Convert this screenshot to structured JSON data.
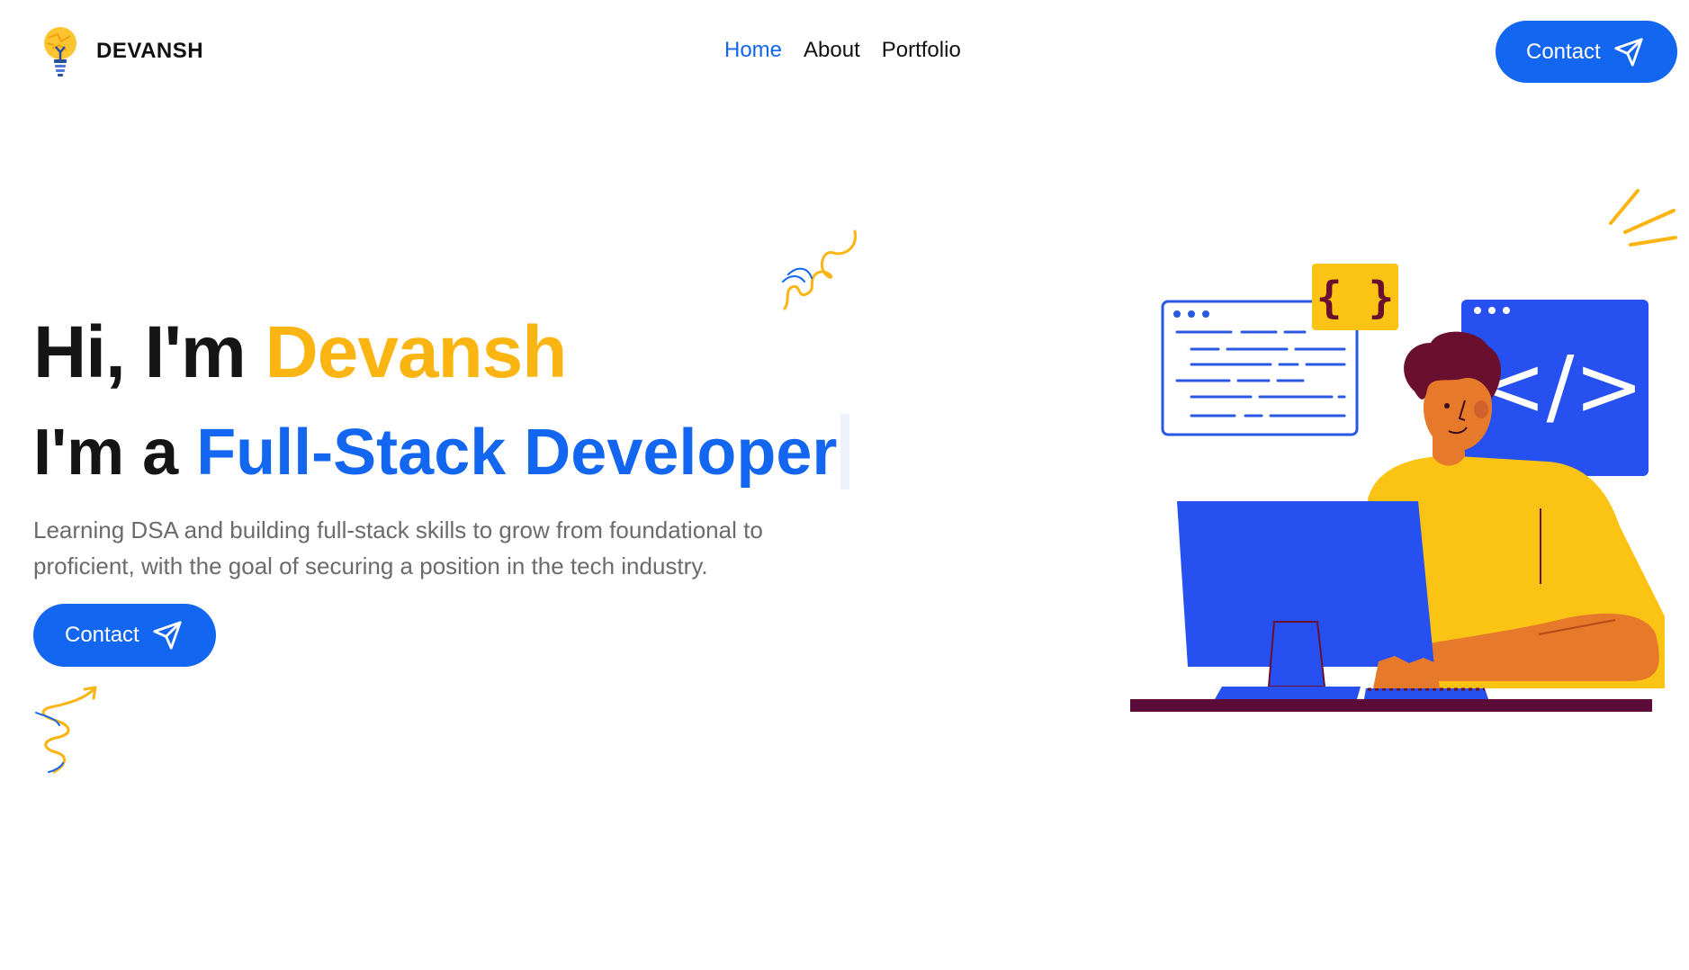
{
  "header": {
    "brand": "DEVANSH",
    "nav": [
      {
        "label": "Home",
        "active": true
      },
      {
        "label": "About",
        "active": false
      },
      {
        "label": "Portfolio",
        "active": false
      }
    ],
    "contact_label": "Contact"
  },
  "hero": {
    "greeting": "Hi, I'm ",
    "name": "Devansh",
    "role_prefix": "I'm a ",
    "role": "Full-Stack Developer",
    "description": "Learning DSA and building full-stack skills to grow from foundational to proficient, with the goal of securing a position in the tech industry.",
    "contact_label": "Contact"
  },
  "colors": {
    "accent_blue": "#1366f0",
    "accent_yellow": "#fbb513",
    "text_dark": "#151515",
    "text_muted": "#6b6b6b"
  },
  "icons": {
    "logo": "lightbulb-icon",
    "contact": "send-icon"
  },
  "illustration": {
    "code_braces": "{ }",
    "code_tag": "</>"
  }
}
